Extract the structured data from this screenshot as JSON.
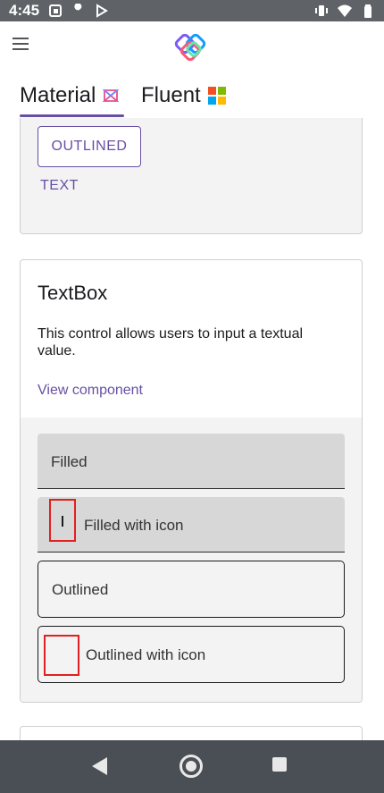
{
  "status_bar": {
    "time": "4:45"
  },
  "tabs": [
    {
      "label": "Material"
    },
    {
      "label": "Fluent"
    }
  ],
  "buttons_card": {
    "outlined_label": "OUTLINED",
    "text_label": "TEXT"
  },
  "textbox_card": {
    "title": "TextBox",
    "description": "This control allows users to input a textual value.",
    "link": "View component",
    "fields": [
      {
        "placeholder": "Filled"
      },
      {
        "placeholder": "Filled with icon"
      },
      {
        "placeholder": "Outlined"
      },
      {
        "placeholder": "Outlined with icon"
      }
    ]
  },
  "colors": {
    "accent": "#6750a4",
    "status_bar": "#5f6368",
    "nav_bar": "#4a4f55",
    "icon_highlight": "#e02020"
  },
  "icons": {
    "menu": "hamburger-icon",
    "logo": "uno-logo-icon",
    "material_tab": "material-icon",
    "fluent_tab": "windows-icon",
    "nav_back": "back-triangle-icon",
    "nav_home": "home-circle-icon",
    "nav_recents": "recents-square-icon"
  }
}
